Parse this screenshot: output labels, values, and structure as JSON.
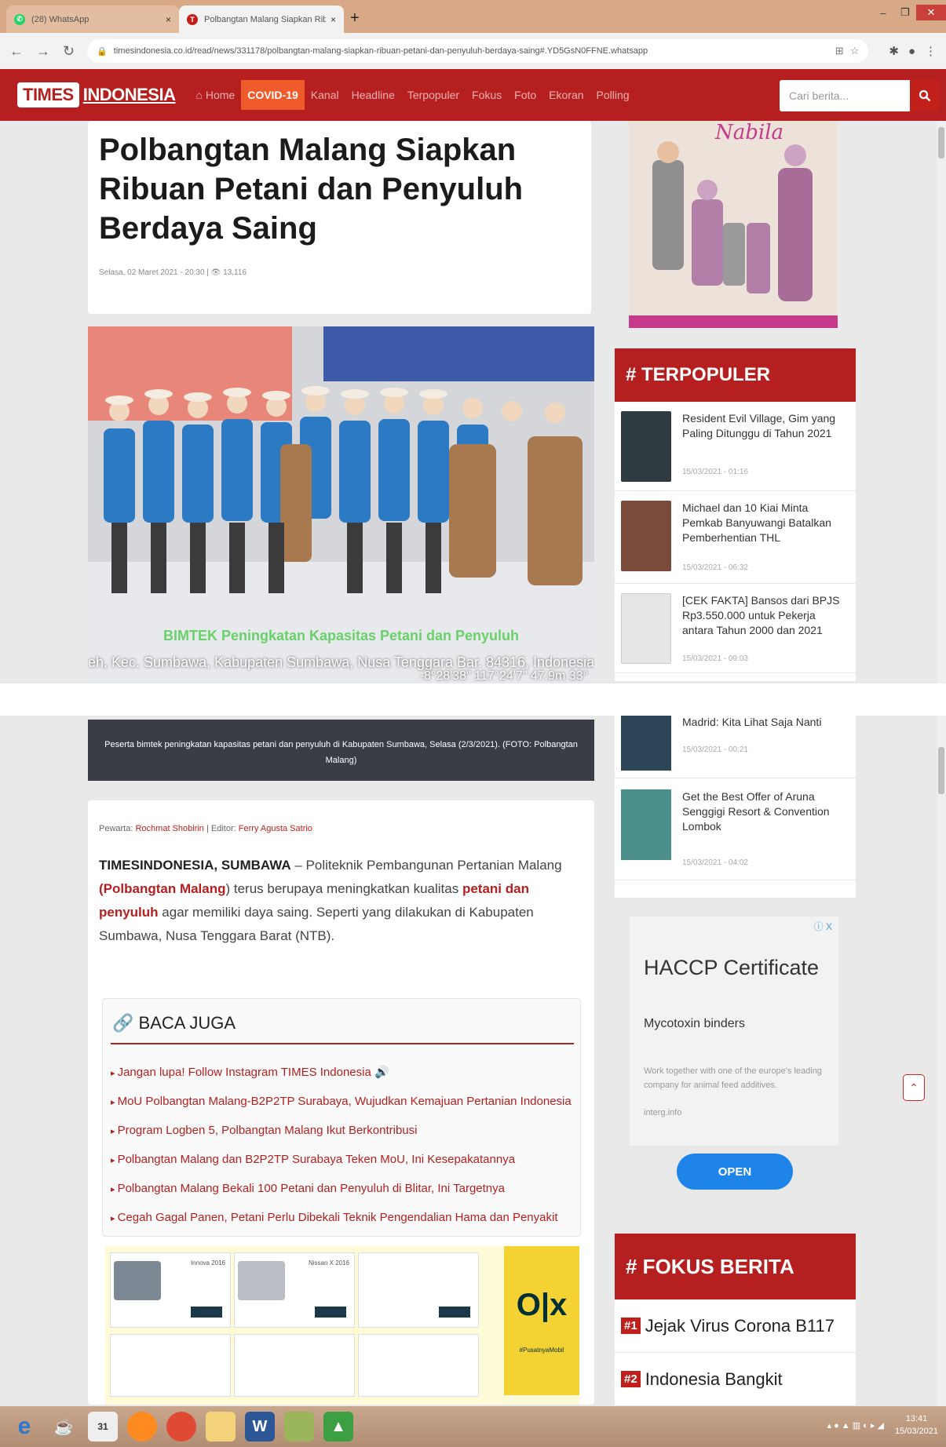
{
  "browser": {
    "tabs": [
      {
        "title": "(28) WhatsApp"
      },
      {
        "title": "Polbangtan Malang Siapkan Rib"
      }
    ],
    "new_tab": "+",
    "tab_close": "×",
    "url": "timesindonesia.co.id/read/news/331178/polbangtan-malang-siapkan-ribuan-petani-dan-penyuluh-berdaya-saing#.YD5GsN0FFNE.whatsapp"
  },
  "site": {
    "logo_box": "TIMES",
    "logo_text": "INDONESIA",
    "menu": [
      "Home",
      "COVID-19",
      "Kanal",
      "Headline",
      "Terpopuler",
      "Fokus",
      "Foto",
      "Ekoran",
      "Polling"
    ],
    "search_placeholder": "Cari berita..."
  },
  "article": {
    "title": "Polbangtan Malang Siapkan Ribuan Petani dan Penyuluh Berdaya Saing",
    "meta": "Selasa, 02 Maret 2021 - 20:30 | 👁 13,116",
    "photo_overlay": "BIMTEK Peningkatan Kapasitas Petani dan Penyuluh",
    "photo_location": "eh, Kec. Sumbawa, Kabupaten Sumbawa, Nusa Tenggara Bar. 84316, Indonesia",
    "photo_coords": "-8°28'38\" 117°24'7\" 47.9m 33°",
    "caption": "Peserta bimtek peningkatan kapasitas petani dan penyuluh di Kabupaten Sumbawa, Selasa (2/3/2021). (FOTO: Polbangtan Malang)",
    "byline_prefix": "Pewarta:",
    "reporter": "Rochmat Shobirin",
    "editor_prefix": "| Editor:",
    "editor": "Ferry Agusta Satrio",
    "lead_source": "TIMESINDONESIA, SUMBAWA",
    "lead_1": " – Politeknik Pembangunan Pertanian Malang ",
    "lead_hl1": "(Polbangtan Malang",
    "lead_2": ") terus berupaya meningkatkan kualitas ",
    "lead_hl2": "petani dan penyuluh",
    "lead_3": " agar memiliki daya saing. Seperti yang dilakukan di Kabupaten Sumbawa, Nusa Tenggara Barat (NTB).",
    "baca_juga": "BACA JUGA",
    "related": [
      "Jangan lupa! Follow Instagram TIMES Indonesia 🔊",
      "MoU Polbangtan Malang-B2P2TP Surabaya, Wujudkan Kemajuan Pertanian Indonesia",
      "Program Logben 5, Polbangtan Malang Ikut Berkontribusi",
      "Polbangtan Malang dan B2P2TP Surabaya Teken MoU, Ini Kesepakatannya",
      "Polbangtan Malang Bekali 100 Petani dan Penyuluh di Blitar, Ini Targetnya",
      "Cegah Gagal Panen, Petani Perlu Dibekali Teknik Pengendalian Hama dan Penyakit"
    ]
  },
  "olx_ad": {
    "cars": [
      "Innova 2016",
      "Nissan X 2016"
    ],
    "logo": "O|x",
    "tag": "#PusatnyaMobil"
  },
  "sidebar": {
    "promo_brand": "Nabila",
    "terpopuler_title": "# TERPOPULER",
    "popular": [
      {
        "title": "Resident Evil Village, Gim yang Paling Ditunggu di Tahun 2021",
        "date": "15/03/2021 - 01:16"
      },
      {
        "title": "Michael dan 10 Kiai Minta Pemkab Banyuwangi Batalkan Pemberhentian THL",
        "date": "15/03/2021 - 06:32"
      },
      {
        "title": "[CEK FAKTA] Bansos dari BPJS Rp3.550.000 untuk Pekerja antara Tahun 2000 dan 2021",
        "date": "15/03/2021 - 09:03"
      },
      {
        "title": "Madrid: Kita Lihat Saja Nanti",
        "date": "15/03/2021 - 00:21"
      },
      {
        "title": "Get the Best Offer of Aruna Senggigi Resort & Convention Lombok",
        "date": "15/03/2021 - 04:02"
      }
    ],
    "fokus_title": "# FOKUS BERITA",
    "fokus": [
      {
        "num": "#1",
        "label": "Jejak Virus Corona B117"
      },
      {
        "num": "#2",
        "label": "Indonesia Bangkit"
      }
    ]
  },
  "haccp_ad": {
    "close": "ⓘ X",
    "title": "HACCP Certificate",
    "subtitle": "Mycotoxin binders",
    "text": "Work together with one of the europe's leading company for animal feed additives.",
    "domain": "interg.info",
    "cta": "OPEN"
  },
  "taskbar": {
    "time": "13:41",
    "date": "15/03/2021"
  },
  "colors": {
    "brand_red": "#b51f1f",
    "covid_orange": "#ef5b2a"
  }
}
